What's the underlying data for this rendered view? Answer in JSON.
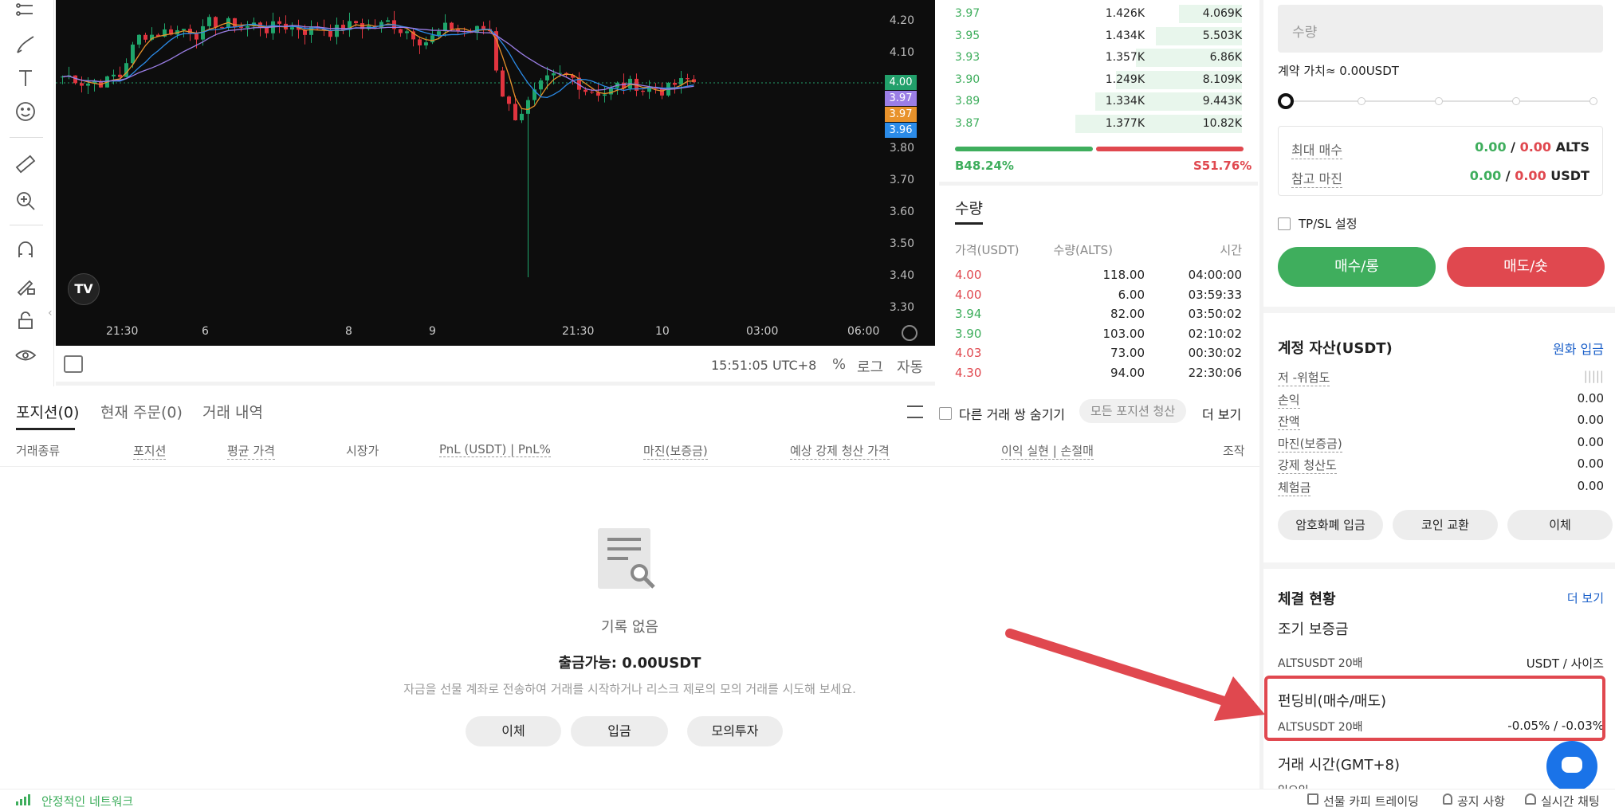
{
  "chart": {
    "y_ticks": [
      "4.20",
      "4.10",
      "3.80",
      "3.70",
      "3.60",
      "3.50",
      "3.40",
      "3.30"
    ],
    "x_ticks": [
      "21:30",
      "6",
      "8",
      "9",
      "21:30",
      "10",
      "03:00",
      "06:00"
    ],
    "price_tags": [
      {
        "value": "4.00",
        "color": "#22a06b"
      },
      {
        "value": "3.97",
        "color": "#9b7ee6"
      },
      {
        "value": "3.97",
        "color": "#e8922b"
      },
      {
        "value": "3.96",
        "color": "#2b8be8"
      }
    ],
    "logo": "TV",
    "time": "15:51:05 UTC+8",
    "options": [
      "%",
      "로그",
      "자동"
    ]
  },
  "orderbook": {
    "rows": [
      {
        "price": "3.97",
        "qty": "1.426K",
        "total": "4.069K",
        "depth": 0.22
      },
      {
        "price": "3.95",
        "qty": "1.434K",
        "total": "5.503K",
        "depth": 0.3
      },
      {
        "price": "3.93",
        "qty": "1.357K",
        "total": "6.86K",
        "depth": 0.37
      },
      {
        "price": "3.90",
        "qty": "1.249K",
        "total": "8.109K",
        "depth": 0.44
      },
      {
        "price": "3.89",
        "qty": "1.334K",
        "total": "9.443K",
        "depth": 0.51
      },
      {
        "price": "3.87",
        "qty": "1.377K",
        "total": "10.82K",
        "depth": 0.58
      }
    ],
    "buy_ratio": "B48.24%",
    "sell_ratio": "S51.76%",
    "buy_fraction": 0.4824
  },
  "trades": {
    "tab": "수량",
    "headers": {
      "price": "가격(USDT)",
      "qty": "수량(ALTS)",
      "time": "시간"
    },
    "rows": [
      {
        "price": "4.00",
        "qty": "118.00",
        "time": "04:00:00",
        "side": "sell"
      },
      {
        "price": "4.00",
        "qty": "6.00",
        "time": "03:59:33",
        "side": "sell"
      },
      {
        "price": "3.94",
        "qty": "82.00",
        "time": "03:50:02",
        "side": "buy"
      },
      {
        "price": "3.90",
        "qty": "103.00",
        "time": "02:10:02",
        "side": "buy"
      },
      {
        "price": "4.03",
        "qty": "73.00",
        "time": "00:30:02",
        "side": "sell"
      },
      {
        "price": "4.30",
        "qty": "94.00",
        "time": "22:30:06",
        "side": "sell"
      }
    ],
    "buy_color": "#3fae5d",
    "sell_color": "#e0484f"
  },
  "positions": {
    "tabs": [
      "포지션(0)",
      "현재 주문(0)",
      "거래 내역"
    ],
    "hide_other": "다른 거래 쌍 숨기기",
    "close_all": "모든 포지션 청산",
    "more": "더 보기",
    "headers": [
      "거래종류",
      "포지션",
      "평균 가격",
      "시장가",
      "PnL (USDT) | PnL%",
      "마진(보증금)",
      "예상 강제 청산 가격",
      "이익 실현 | 손절매",
      "조작"
    ],
    "empty_text": "기록 없음",
    "withdrawable": "출금가능: 0.00USDT",
    "hint": "자금을 선물 계좌로 전송하여 거래를 시작하거나 리스크 제로의 모의 거래를 시도해 보세요.",
    "buttons": [
      "이체",
      "입금",
      "모의투자"
    ]
  },
  "order_form": {
    "qty_placeholder": "수량",
    "contract_value": "계약 가치≈  0.00USDT",
    "slider_value": 0,
    "max_buy_label": "최대 매수",
    "max_buy_green": "0.00",
    "max_buy_red": "0.00",
    "max_buy_unit": "ALTS",
    "ref_margin_label": "참고 마진",
    "ref_margin_green": "0.00",
    "ref_margin_red": "0.00",
    "ref_margin_unit": "USDT",
    "tpsl": "TP/SL 설정",
    "buy_button": "매수/롱",
    "sell_button": "매도/숏"
  },
  "account": {
    "title": "계정 자산(USDT)",
    "action": "원화 입금",
    "rows": [
      {
        "label": "저 -위험도",
        "value": "|||||"
      },
      {
        "label": "손익",
        "value": "0.00"
      },
      {
        "label": "잔액",
        "value": "0.00"
      },
      {
        "label": "마진(보증금)",
        "value": "0.00"
      },
      {
        "label": "강제 청산도",
        "value": "0.00"
      },
      {
        "label": "체험금",
        "value": "0.00"
      }
    ],
    "buttons": [
      "암호화폐 입금",
      "코인 교환",
      "이체"
    ]
  },
  "contract": {
    "title": "체결 현황",
    "more": "더 보기",
    "initial_label": "조기 보증금",
    "pair_1": "ALTSUSDT 20배",
    "unit_1": "USDT / 사이즈",
    "funding_label": "펀딩비(매수/매도)",
    "pair_2": "ALTSUSDT 20배",
    "funding_value": "-0.05% / -0.03%",
    "trading_time": "거래 시간(GMT+8)",
    "cut_text": "일요일"
  },
  "footer": {
    "network": "안정적인 네트워크",
    "links": [
      "선물 카피 트레이딩",
      "공지 사항",
      "실시간 채팅"
    ]
  }
}
